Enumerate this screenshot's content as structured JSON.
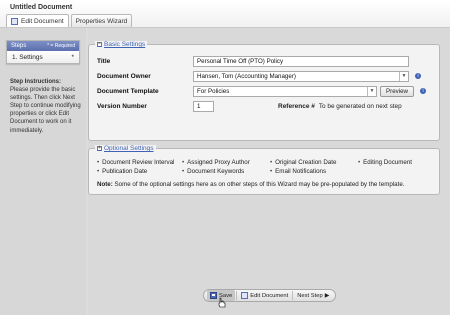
{
  "header": {
    "title": "Untitled Document",
    "tabs": [
      {
        "label": "Edit Document",
        "icon": "document-icon"
      },
      {
        "label": "Properties Wizard"
      }
    ]
  },
  "sidebar": {
    "steps_title": "Steps",
    "required_label": "* = Required",
    "steps": [
      {
        "label": "1. Settings",
        "marker": "*"
      }
    ],
    "instructions_title": "Step Instructions:",
    "instructions_text": "Please provide the basic settings. Then click Next Step to continue modifying properties or click Edit Document to work on it immediately."
  },
  "basic": {
    "title": "Basic Settings",
    "title_label": "Title",
    "title_value": "Personal Time Off (PTO) Policy",
    "owner_label": "Document Owner",
    "owner_value": "Hansen, Tom (Accounting Manager)",
    "template_label": "Document Template",
    "template_value": "For Policies",
    "preview_button": "Preview",
    "version_label": "Version Number",
    "version_value": "1",
    "reference_label": "Reference #",
    "reference_value": "To be generated on next step"
  },
  "optional": {
    "title": "Optional Settings",
    "items": [
      "Document Review Interval",
      "Assigned Proxy Author",
      "Original Creation Date",
      "Editing Document",
      "Publication Date",
      "Document Keywords",
      "Email Notifications"
    ],
    "note_label": "Note:",
    "note_text": "Some of the optional settings here as on other steps of this Wizard may be pre-populated by the template."
  },
  "toolbar": {
    "save_label": "Save",
    "edit_label": "Edit Document",
    "next_label": "Next Step"
  },
  "colors": {
    "accent": "#3f62b5",
    "steps_header": "#6b7fbe",
    "background": "#d9d9d9"
  }
}
